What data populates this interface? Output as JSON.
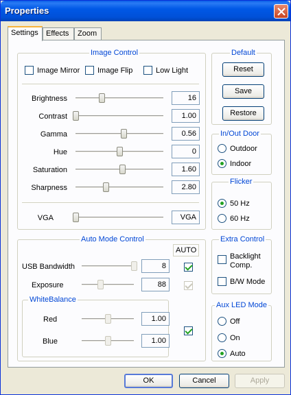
{
  "window": {
    "title": "Properties"
  },
  "tabs": [
    "Settings",
    "Effects",
    "Zoom"
  ],
  "image_control": {
    "legend": "Image Control",
    "checkboxes": [
      {
        "label": "Image Mirror",
        "checked": false
      },
      {
        "label": "Image Flip",
        "checked": false
      },
      {
        "label": "Low Light",
        "checked": false
      }
    ],
    "sliders": [
      {
        "label": "Brightness",
        "value": "16",
        "level": 0.3
      },
      {
        "label": "Contrast",
        "value": "1.00",
        "level": 0.0
      },
      {
        "label": "Gamma",
        "value": "0.56",
        "level": 0.55
      },
      {
        "label": "Hue",
        "value": "0",
        "level": 0.5
      },
      {
        "label": "Saturation",
        "value": "1.60",
        "level": 0.53
      },
      {
        "label": "Sharpness",
        "value": "2.80",
        "level": 0.34
      }
    ],
    "vga": {
      "label": "VGA",
      "value": "VGA",
      "level": 0.0
    }
  },
  "default_group": {
    "legend": "Default",
    "reset": "Reset",
    "save": "Save",
    "restore": "Restore"
  },
  "inout_door": {
    "legend": "In/Out Door",
    "options": [
      {
        "label": "Outdoor",
        "checked": false
      },
      {
        "label": "Indoor",
        "checked": true
      }
    ]
  },
  "flicker": {
    "legend": "Flicker",
    "options": [
      {
        "label": "50 Hz",
        "checked": true
      },
      {
        "label": "60 Hz",
        "checked": false
      }
    ]
  },
  "auto_mode": {
    "legend": "Auto Mode Control",
    "auto_label": "AUTO",
    "usb_bandwidth": {
      "label": "USB Bandwidth",
      "value": "8",
      "level": 1.0,
      "auto": true
    },
    "exposure": {
      "label": "Exposure",
      "value": "88",
      "level": 0.35,
      "auto": true
    },
    "white_balance": {
      "legend": "WhiteBalance",
      "red": {
        "label": "Red",
        "value": "1.00",
        "level": 0.5
      },
      "blue": {
        "label": "Blue",
        "value": "1.00",
        "level": 0.5
      },
      "auto": true
    }
  },
  "extra_control": {
    "legend": "Extra Control",
    "backlight": {
      "label1": "Backlight",
      "label2": "Comp.",
      "checked": false
    },
    "bw_mode": {
      "label": "B/W Mode",
      "checked": false
    }
  },
  "aux_led": {
    "legend": "Aux LED Mode",
    "options": [
      {
        "label": "Off",
        "checked": false
      },
      {
        "label": "On",
        "checked": false
      },
      {
        "label": "Auto",
        "checked": true
      }
    ]
  },
  "buttons": {
    "ok": "OK",
    "cancel": "Cancel",
    "apply": "Apply"
  },
  "colors": {
    "accent": "#0046d5",
    "check": "#21a121"
  }
}
